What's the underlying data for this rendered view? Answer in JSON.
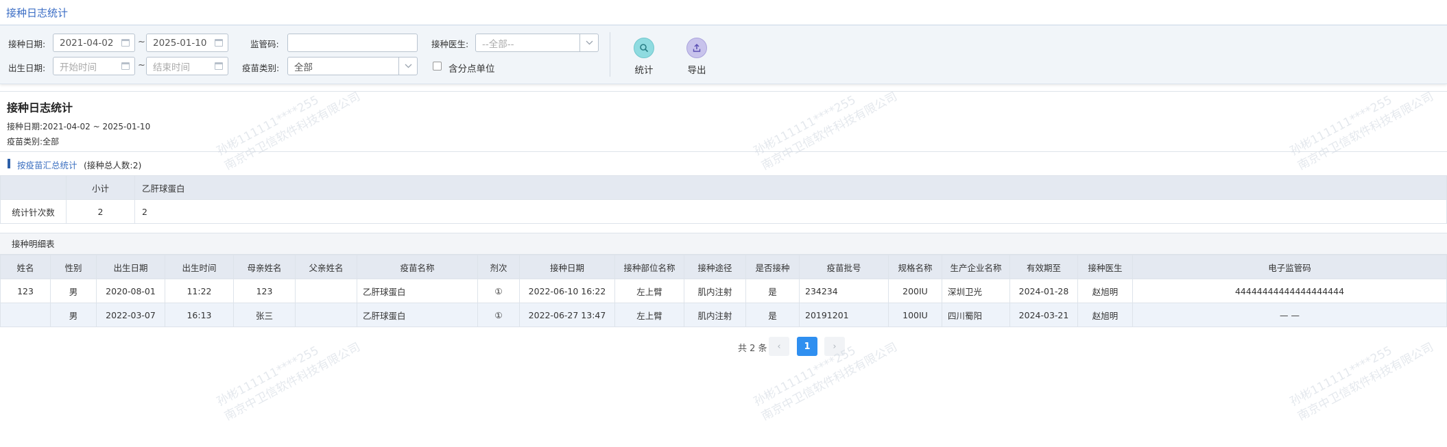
{
  "page": {
    "title": "接种日志统计"
  },
  "filters": {
    "vacc_date_label": "接种日期:",
    "vacc_date_from": "2021-04-02",
    "vacc_date_to": "2025-01-10",
    "range_sep": "~",
    "birth_date_label": "出生日期:",
    "birth_start_placeholder": "开始时间",
    "birth_end_placeholder": "结束时间",
    "supervision_code_label": "监管码:",
    "supervision_code_value": "",
    "vaccine_type_label": "疫苗类别:",
    "vaccine_type_value": "全部",
    "doctor_label": "接种医生:",
    "doctor_value": "--全部--",
    "include_sub_label": "含分点单位",
    "include_sub_checked": false
  },
  "actions": {
    "stats_label": "统计",
    "export_label": "导出",
    "stats_icon": "magnifier-icon",
    "export_icon": "upload-icon",
    "stats_color": "#8fdbe0",
    "export_color": "#c8c3ec"
  },
  "report": {
    "title": "接种日志统计",
    "date_line": "接种日期:2021-04-02 ~ 2025-01-10",
    "type_line": "疫苗类别:全部"
  },
  "summary": {
    "link": "按疫苗汇总统计",
    "count_text": "(接种总人数:2)",
    "headers": [
      "",
      "小计",
      "乙肝球蛋白"
    ],
    "row": [
      "统计针次数",
      "2",
      "2"
    ]
  },
  "detail": {
    "title": "接种明细表",
    "columns": [
      "姓名",
      "性别",
      "出生日期",
      "出生时间",
      "母亲姓名",
      "父亲姓名",
      "疫苗名称",
      "剂次",
      "接种日期",
      "接种部位名称",
      "接种途径",
      "是否接种",
      "疫苗批号",
      "规格名称",
      "生产企业名称",
      "有效期至",
      "接种医生",
      "电子监管码"
    ],
    "rows": [
      [
        "123",
        "男",
        "2020-08-01",
        "11:22",
        "123",
        "",
        "乙肝球蛋白",
        "①",
        "2022-06-10 16:22",
        "左上臂",
        "肌内注射",
        "是",
        "234234",
        "200IU",
        "深圳卫光",
        "2024-01-28",
        "赵旭明",
        "44444444444444444444"
      ],
      [
        "",
        "男",
        "2022-03-07",
        "16:13",
        "张三",
        "",
        "乙肝球蛋白",
        "①",
        "2022-06-27 13:47",
        "左上臂",
        "肌内注射",
        "是",
        "20191201",
        "100IU",
        "四川蜀阳",
        "2024-03-21",
        "赵旭明",
        "— —"
      ]
    ]
  },
  "pagination": {
    "total_text": "共 2 条",
    "prev": "‹",
    "current": "1",
    "next": "›",
    "active_color": "#2f8ff0"
  },
  "watermark": {
    "line1": "孙彬111111****255",
    "line2": "南京中卫信软件科技有限公司"
  }
}
